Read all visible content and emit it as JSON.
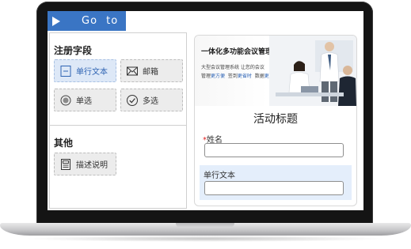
{
  "goto": {
    "label": "Go to",
    "color": "#3a75c4"
  },
  "left_panel": {
    "section_fields_title": "注册字段",
    "section_other_title": "其他",
    "fields": [
      {
        "label": "单行文本",
        "icon": "single-line-text-icon",
        "selected": true
      },
      {
        "label": "邮箱",
        "icon": "envelope-icon",
        "selected": false
      },
      {
        "label": "单选",
        "icon": "radio-icon",
        "selected": false
      },
      {
        "label": "多选",
        "icon": "checkbox-icon",
        "selected": false
      }
    ],
    "other_fields": [
      {
        "label": "描述说明",
        "icon": "description-icon"
      }
    ]
  },
  "preview": {
    "banner": {
      "title": "一体化多功能会议管理系统",
      "subtitle_line1": "大型会议管理系统 让您的会议",
      "subtitle_prefix_1": "管理",
      "subtitle_highlight_1": "更方便",
      "subtitle_prefix_2": "签到",
      "subtitle_highlight_2": "更省时",
      "subtitle_prefix_3": "数据",
      "subtitle_highlight_3": "更安全"
    },
    "form_title": "活动标题",
    "name_field": {
      "required_mark": "*",
      "label": "姓名",
      "value": ""
    },
    "text_field": {
      "label": "单行文本",
      "value": ""
    }
  },
  "colors": {
    "accent": "#3a75c4",
    "selected_bg": "#dde8f7",
    "row_highlight": "#e4eefb",
    "required": "#e02020"
  }
}
